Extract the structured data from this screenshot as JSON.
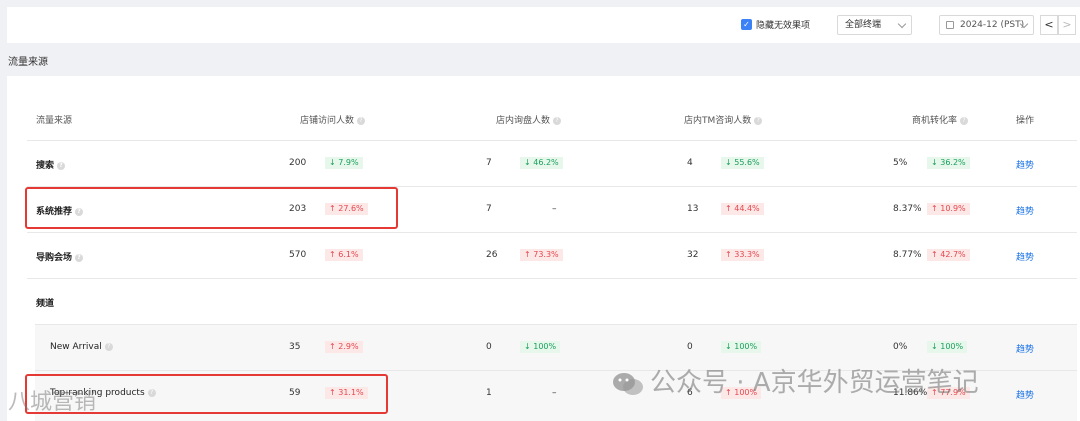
{
  "toolbar": {
    "hide_invalid_label": "隐藏无效果项",
    "terminal_value": "全部终端",
    "date_value": "2024-12 (PST)",
    "prev_label": "<",
    "next_label": ">"
  },
  "section_title": "流量来源",
  "columns": [
    "流量来源",
    "店铺访问人数",
    "店内询盘人数",
    "店内TM咨询人数",
    "商机转化率",
    "操作"
  ],
  "rows": [
    {
      "label": "搜索",
      "visits": "200",
      "visits_change": "↓ 7.9%",
      "inquiries": "7",
      "inquiries_change": "↓ 46.2%",
      "tm": "4",
      "tm_change": "↓ 55.6%",
      "rate": "5%",
      "rate_change": "↓ 36.2%",
      "action": "趋势"
    },
    {
      "label": "系统推荐",
      "visits": "203",
      "visits_change": "↑ 27.6%",
      "inquiries": "7",
      "inquiries_change": "–",
      "tm": "13",
      "tm_change": "↑ 44.4%",
      "rate": "8.37%",
      "rate_change": "↑ 10.9%",
      "action": "趋势"
    },
    {
      "label": "导购会场",
      "visits": "570",
      "visits_change": "↑ 6.1%",
      "inquiries": "26",
      "inquiries_change": "↑ 73.3%",
      "tm": "32",
      "tm_change": "↑ 33.3%",
      "rate": "8.77%",
      "rate_change": "↑ 42.7%",
      "action": "趋势"
    },
    {
      "label": "频道"
    },
    {
      "label": "New Arrival",
      "visits": "35",
      "visits_change": "↑ 2.9%",
      "inquiries": "0",
      "inquiries_change": "↓ 100%",
      "tm": "0",
      "tm_change": "↓ 100%",
      "rate": "0%",
      "rate_change": "↓ 100%",
      "action": "趋势"
    },
    {
      "label": "Top-ranking products",
      "visits": "59",
      "visits_change": "↑ 31.1%",
      "inquiries": "1",
      "inquiries_change": "–",
      "tm": "6",
      "tm_change": "↑ 100%",
      "rate": "11.86%",
      "rate_change": "↑ 77.9%",
      "action": "趋势"
    }
  ],
  "watermark": {
    "text": "公众号 · A京华外贸运营笔记",
    "left_text": "八城营销"
  },
  "colors": {
    "accent": "#3b82f6",
    "up": "#e5484d",
    "down": "#19a05b",
    "link": "#1a73e8",
    "highlight": "#e53935"
  }
}
